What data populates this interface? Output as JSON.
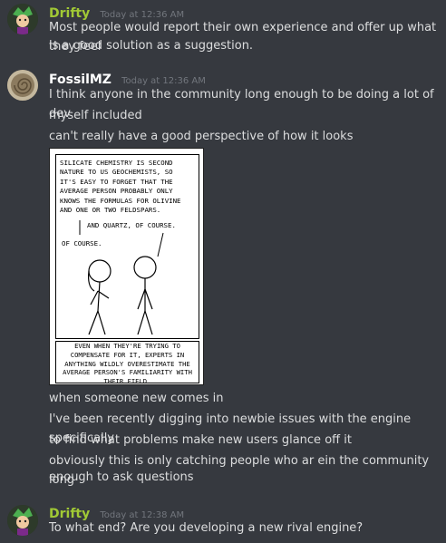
{
  "messages": [
    {
      "username": "Drifty",
      "username_color": "#a1c935",
      "timestamp": "Today at 12:36 AM",
      "lines": [
        "Most people would report their own experience and offer up what they feel",
        "is a good solution as a suggestion."
      ]
    },
    {
      "username": "FossilMZ",
      "username_color": "#ffffff",
      "timestamp": "Today at 12:36 AM",
      "lines": [
        "I think anyone in the community long enough to be doing a lot of dev",
        "myself included",
        "can't really have a good perspective of how it looks"
      ],
      "comic": {
        "panel_text": "SILICATE CHEMISTRY IS SECOND\nNATURE TO US GEOCHEMISTS, SO\nIT'S EASY TO FORGET THAT THE\nAVERAGE PERSON PROBABLY ONLY\nKNOWS THE FORMULAS FOR OLIVINE\nAND ONE OR TWO FELDSPARS.",
        "speech_right": "AND QUARTZ, OF COURSE.",
        "speech_left": "OF COURSE.",
        "caption": "EVEN WHEN THEY'RE TRYING TO COMPENSATE FOR IT, EXPERTS IN ANYTHING WILDLY OVERESTIMATE THE AVERAGE PERSON'S FAMILIARITY WITH THEIR FIELD."
      },
      "after_lines": [
        "when someone new comes in",
        "I've been recently digging into newbie issues with the engine specifically",
        "to find what problems make new users glance off it",
        "obviously this is only catching people who ar ein the community long",
        "enough to ask questions"
      ]
    },
    {
      "username": "Drifty",
      "username_color": "#a1c935",
      "timestamp": "Today at 12:38 AM",
      "lines": [
        "To what end? Are you developing a new rival engine?"
      ]
    }
  ]
}
